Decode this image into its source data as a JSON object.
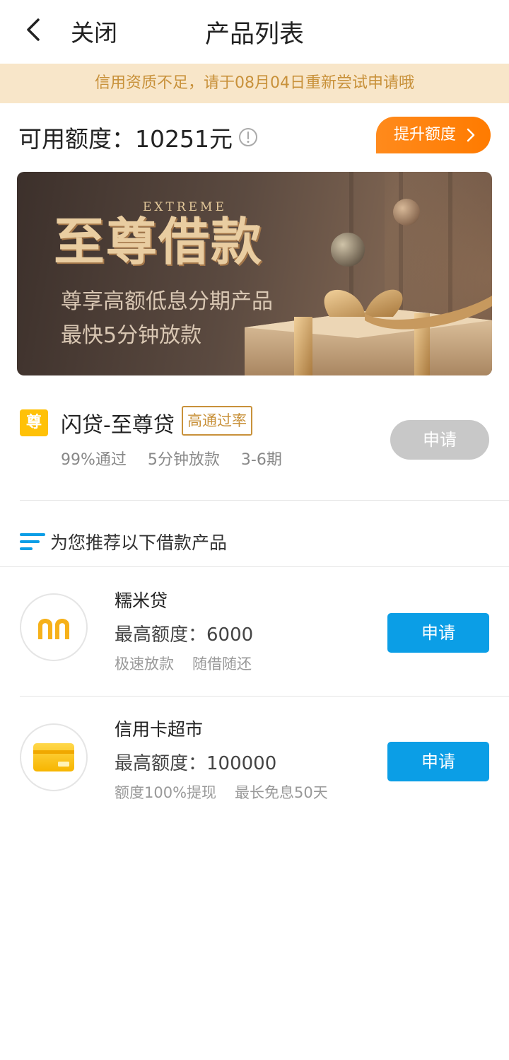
{
  "header": {
    "close_label": "关闭",
    "title": "产品列表"
  },
  "notice": "信用资质不足，请于08月04日重新尝试申请哦",
  "quota": {
    "label": "可用额度：10251元",
    "raise_button": "提升额度"
  },
  "banner": {
    "tag": "EXTREME",
    "title": "至尊借款",
    "subtitle1": "尊享高额低息分期产品",
    "subtitle2": "最快5分钟放款"
  },
  "featured": {
    "badge": "尊",
    "name": "闪贷-至尊贷",
    "tag": "高通过率",
    "meta": [
      "99%通过",
      "5分钟放款",
      "3-6期"
    ],
    "apply": "申请"
  },
  "recommend": {
    "title": "为您推荐以下借款产品",
    "items": [
      {
        "name": "糯米贷",
        "limit": "最高额度：6000",
        "tags": [
          "极速放款",
          "随借随还"
        ],
        "apply": "申请",
        "icon": "nuomi-logo-icon"
      },
      {
        "name": "信用卡超市",
        "limit": "最高额度：100000",
        "tags": [
          "额度100%提现",
          "最长免息50天"
        ],
        "apply": "申请",
        "icon": "credit-card-icon"
      }
    ]
  },
  "colors": {
    "accent_blue": "#0b9ee6",
    "orange": "#ff8a1c",
    "notice_bg": "#f8e6c9",
    "notice_text": "#c8913a"
  }
}
